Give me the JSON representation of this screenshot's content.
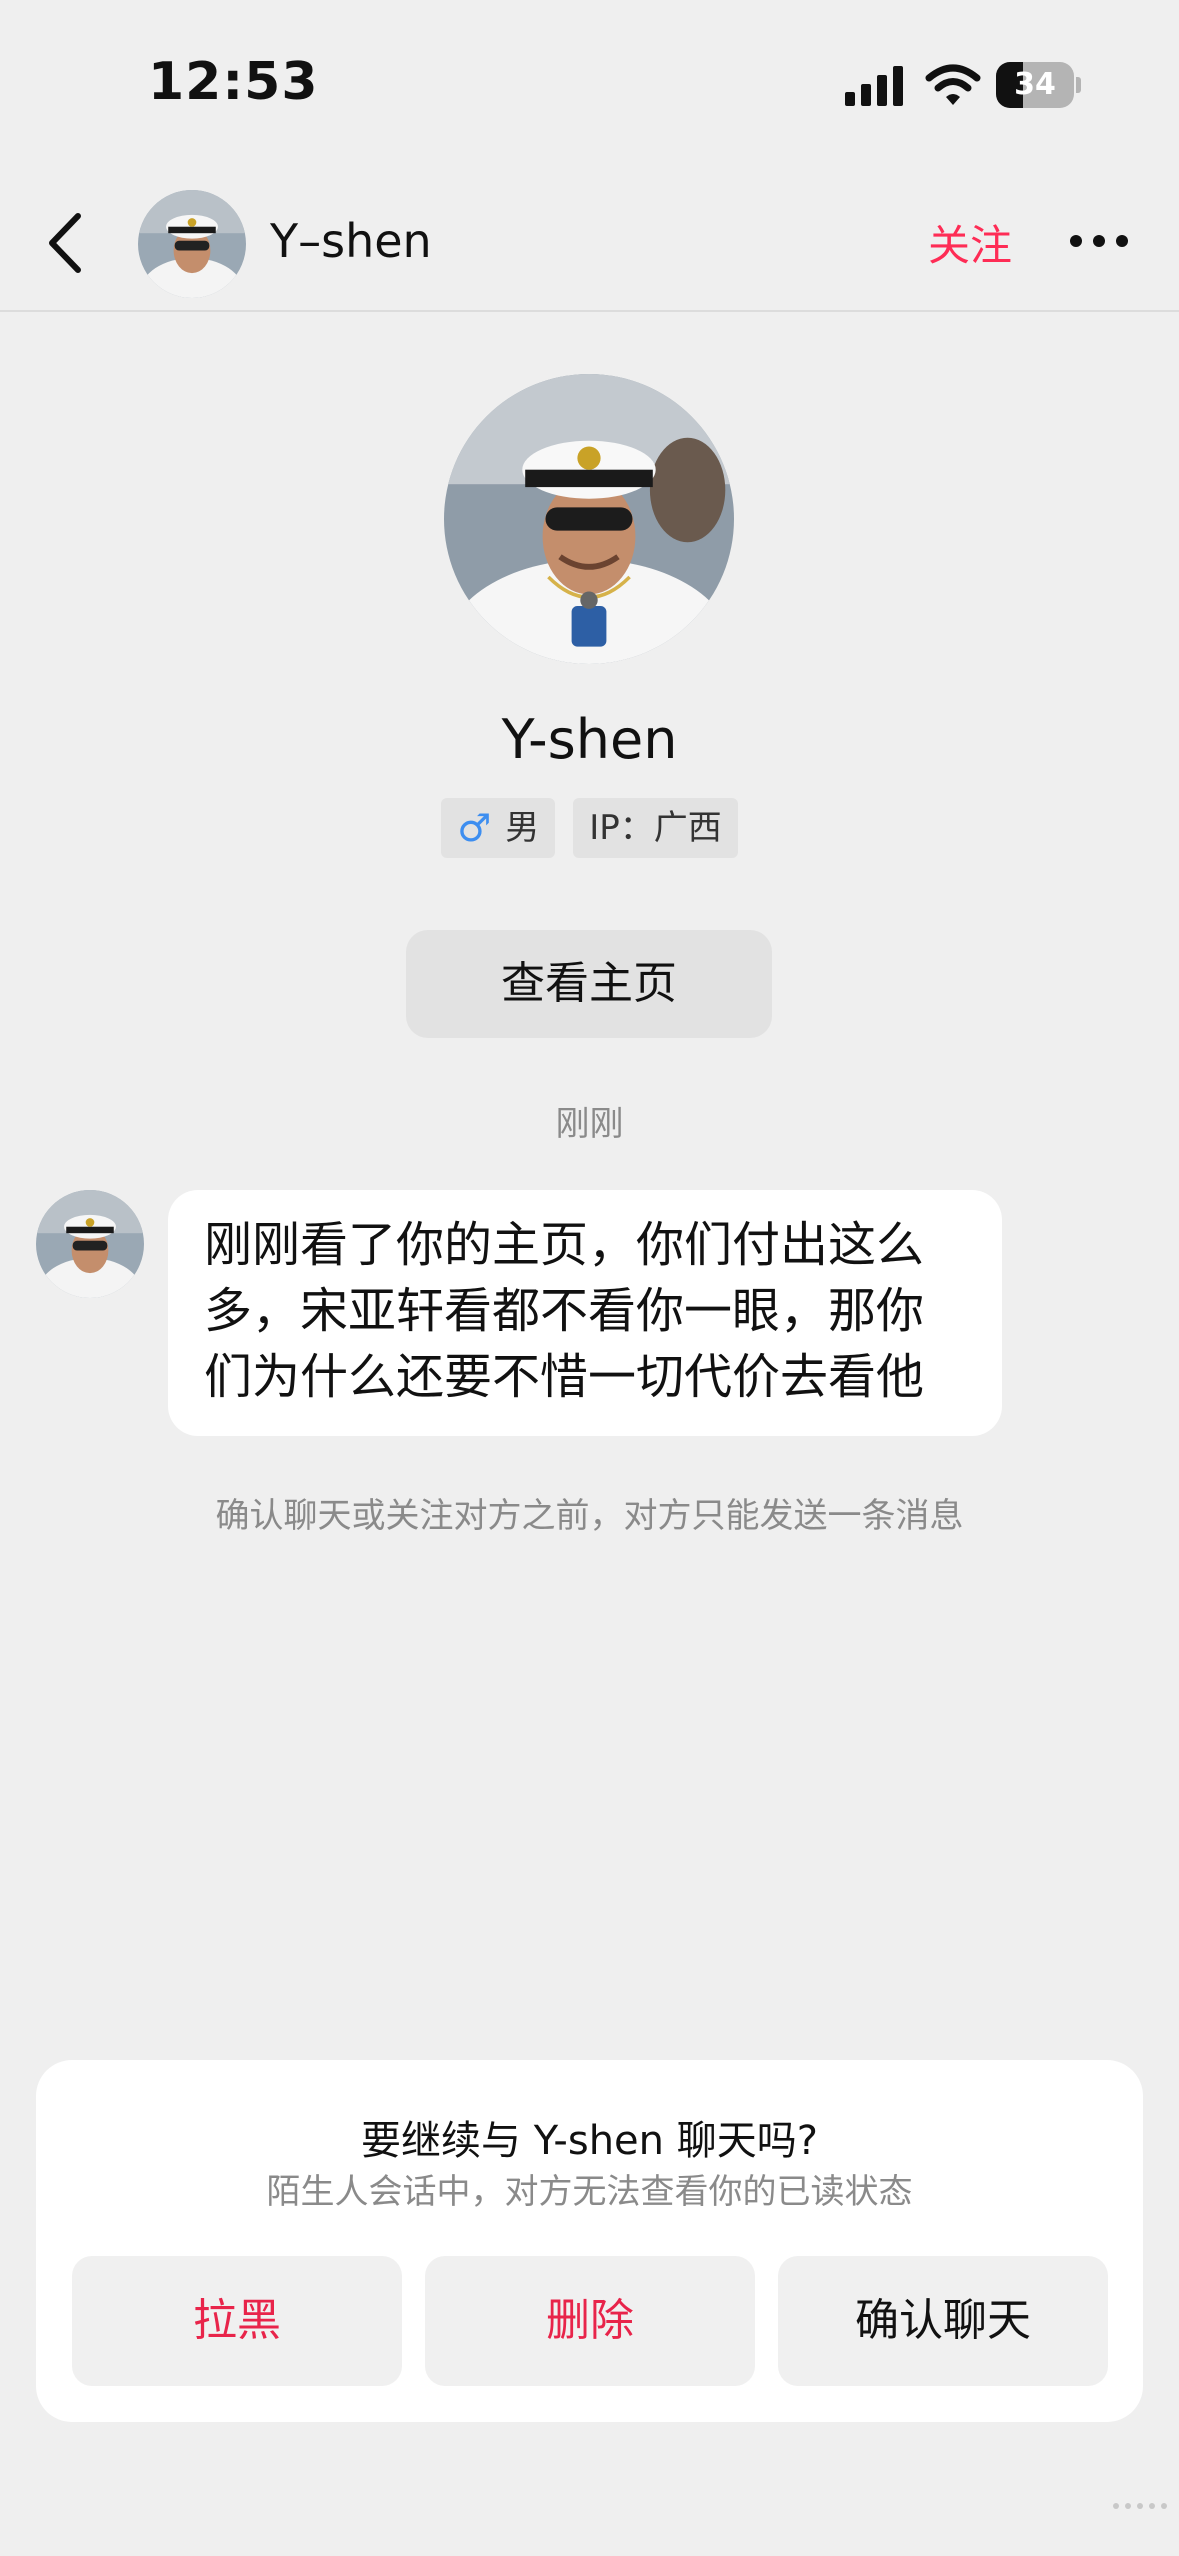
{
  "status_bar": {
    "time": "12:53",
    "battery": "34",
    "battery_level": 0.34
  },
  "nav": {
    "username": "Y–shen",
    "follow_label": "关注"
  },
  "profile": {
    "name": "Y-shen",
    "gender_symbol": "♂",
    "gender": "男",
    "ip_label": "IP：广西",
    "view_profile_label": "查看主页"
  },
  "chat": {
    "time_label": "刚刚",
    "message_lines": [
      "刚刚看了你的主页，你们付出这么",
      "多，宋亚轩看都不看你一眼，那你",
      "们为什么还要不惜一切代价去看他"
    ],
    "notice": "确认聊天或关注对方之前，对方只能发送一条消息"
  },
  "prompt_card": {
    "title": "要继续与 Y-shen 聊天吗?",
    "subtitle": "陌生人会话中，对方无法查看你的已读状态",
    "block_label": "拉黑",
    "delete_label": "删除",
    "confirm_label": "确认聊天"
  },
  "colors": {
    "accent": "#fe2c55",
    "background": "#efefef",
    "danger": "#e8244a"
  }
}
